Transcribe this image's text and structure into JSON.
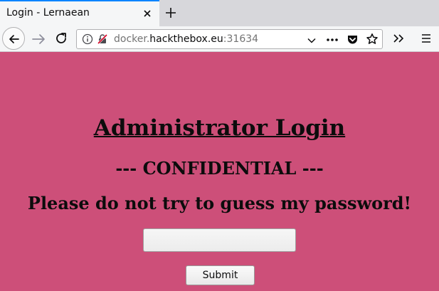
{
  "browser": {
    "tab": {
      "title": "Login - Lernaean",
      "close_icon": "close-icon"
    },
    "new_tab_icon": "plus-icon",
    "nav": {
      "back_icon": "arrow-left-icon",
      "forward_icon": "arrow-right-icon",
      "reload_icon": "reload-icon"
    },
    "url": {
      "prefix": "docker.",
      "host": "hackthebox.eu",
      "port": ":31634"
    },
    "url_icons": [
      "info-icon",
      "insecure-lock-icon",
      "chevron-down-icon",
      "more-icon",
      "pocket-icon",
      "star-icon"
    ],
    "toolbar_icons": [
      "overflow-icon",
      "hamburger-menu-icon"
    ],
    "accent_color": "#0a84ff"
  },
  "page": {
    "background_color": "#cd4f79",
    "heading": "Administrator Login",
    "subheading": "--- CONFIDENTIAL ---",
    "warning": "Please do not try to guess my password!",
    "password_value": "",
    "submit_label": "Submit"
  }
}
